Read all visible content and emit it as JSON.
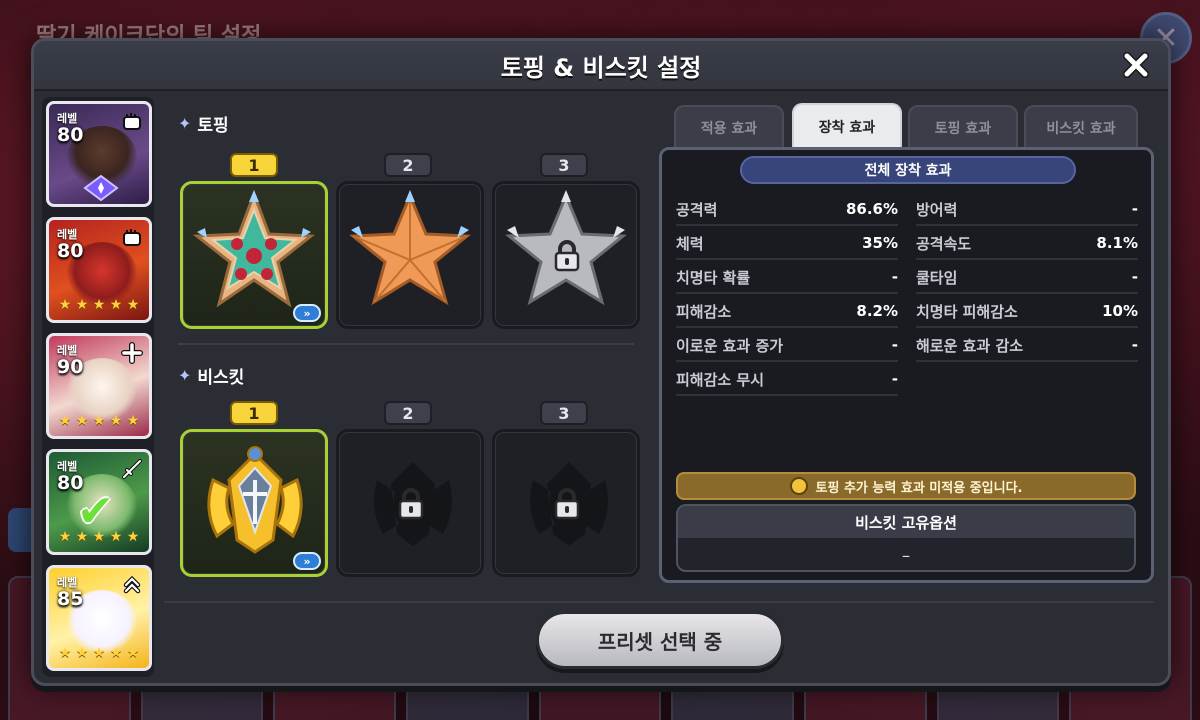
{
  "background": {
    "title": "딸기 케이크단의 팀 설정"
  },
  "dialog": {
    "title": "토핑 & 비스킷 설정",
    "close_icon": "close-icon"
  },
  "cookies": [
    {
      "level_label": "레벨",
      "level": "80",
      "type_icon": "fist-icon",
      "stars": 0,
      "selected": false
    },
    {
      "level_label": "레벨",
      "level": "80",
      "type_icon": "fist-icon",
      "stars": 5,
      "selected": false
    },
    {
      "level_label": "레벨",
      "level": "90",
      "type_icon": "plus-icon",
      "stars": 5,
      "selected": false
    },
    {
      "level_label": "레벨",
      "level": "80",
      "type_icon": "sword-icon",
      "stars": 5,
      "selected": true
    },
    {
      "level_label": "레벨",
      "level": "85",
      "type_icon": "chevron-up-icon",
      "stars": 5,
      "selected": false
    }
  ],
  "toppings": {
    "label": "토핑",
    "slots": [
      {
        "num": "1",
        "active": true,
        "locked": false,
        "kind": "decorated-star"
      },
      {
        "num": "2",
        "active": false,
        "locked": false,
        "kind": "orange-star"
      },
      {
        "num": "3",
        "active": false,
        "locked": true,
        "kind": "silver-star"
      }
    ]
  },
  "biscuits": {
    "label": "비스킷",
    "slots": [
      {
        "num": "1",
        "active": true,
        "locked": false,
        "kind": "gold-crest"
      },
      {
        "num": "2",
        "active": false,
        "locked": true,
        "kind": "empty"
      },
      {
        "num": "3",
        "active": false,
        "locked": true,
        "kind": "empty"
      }
    ]
  },
  "tabs": [
    {
      "label": "적용 효과",
      "active": false
    },
    {
      "label": "장착 효과",
      "active": true
    },
    {
      "label": "토핑 효과",
      "active": false
    },
    {
      "label": "비스킷 효과",
      "active": false
    }
  ],
  "effects": {
    "header": "전체 장착 효과",
    "left": [
      {
        "name": "공격력",
        "value": "86.6%"
      },
      {
        "name": "체력",
        "value": "35%"
      },
      {
        "name": "치명타 확률",
        "value": "-"
      },
      {
        "name": "피해감소",
        "value": "8.2%"
      },
      {
        "name": "이로운 효과 증가",
        "value": "-"
      },
      {
        "name": "피해감소 무시",
        "value": "-"
      }
    ],
    "right": [
      {
        "name": "방어력",
        "value": "-"
      },
      {
        "name": "공격속도",
        "value": "8.1%"
      },
      {
        "name": "쿨타임",
        "value": "-"
      },
      {
        "name": "치명타 피해감소",
        "value": "10%"
      },
      {
        "name": "해로운 효과 감소",
        "value": "-"
      }
    ],
    "notice": "토핑 추가 능력 효과 미적용 중입니다.",
    "biscuit_option_title": "비스킷 고유옵션",
    "biscuit_option_value": "–"
  },
  "footer": {
    "preset_label": "프리셋 선택 중"
  },
  "colors": {
    "active_slot_border": "#a8d233",
    "active_number": "#f7d43a",
    "notice_bg": "#8a6a2a",
    "star": "#ffd23c"
  }
}
